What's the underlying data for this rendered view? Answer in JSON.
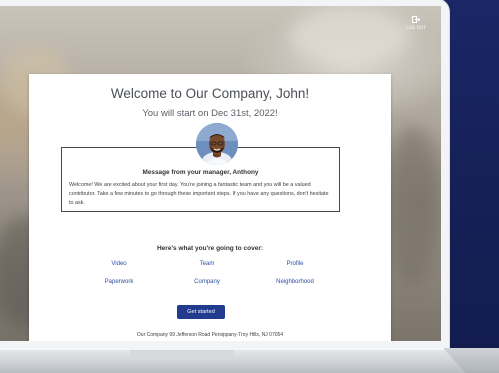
{
  "header": {
    "logout_label": "LOG OUT"
  },
  "welcome": {
    "title": "Welcome to Our Company, John!",
    "subtitle": "You will start on Dec 31st, 2022!"
  },
  "message": {
    "heading": "Message from your manager, Anthony",
    "body": "Welcome! We are excited about your first day. You're joining a fantastic team and you will be a valued contributor. Take a few minutes to go through these important steps. If you have any questions, don't hesitate to ask."
  },
  "cover": {
    "heading": "Here's what you're going to cover:",
    "links": [
      "Video",
      "Team",
      "Profile",
      "Paperwork",
      "Company",
      "Neighborhood"
    ]
  },
  "cta": {
    "label": "Get started"
  },
  "footer": {
    "address": "Our Company 99 Jefferson Road Persippany-Troy Hills, NJ 07054"
  },
  "colors": {
    "page_bg": "#16215a",
    "accent": "#213c8e",
    "link": "#2e4fa0"
  },
  "icons": {
    "logout": "logout-icon"
  }
}
